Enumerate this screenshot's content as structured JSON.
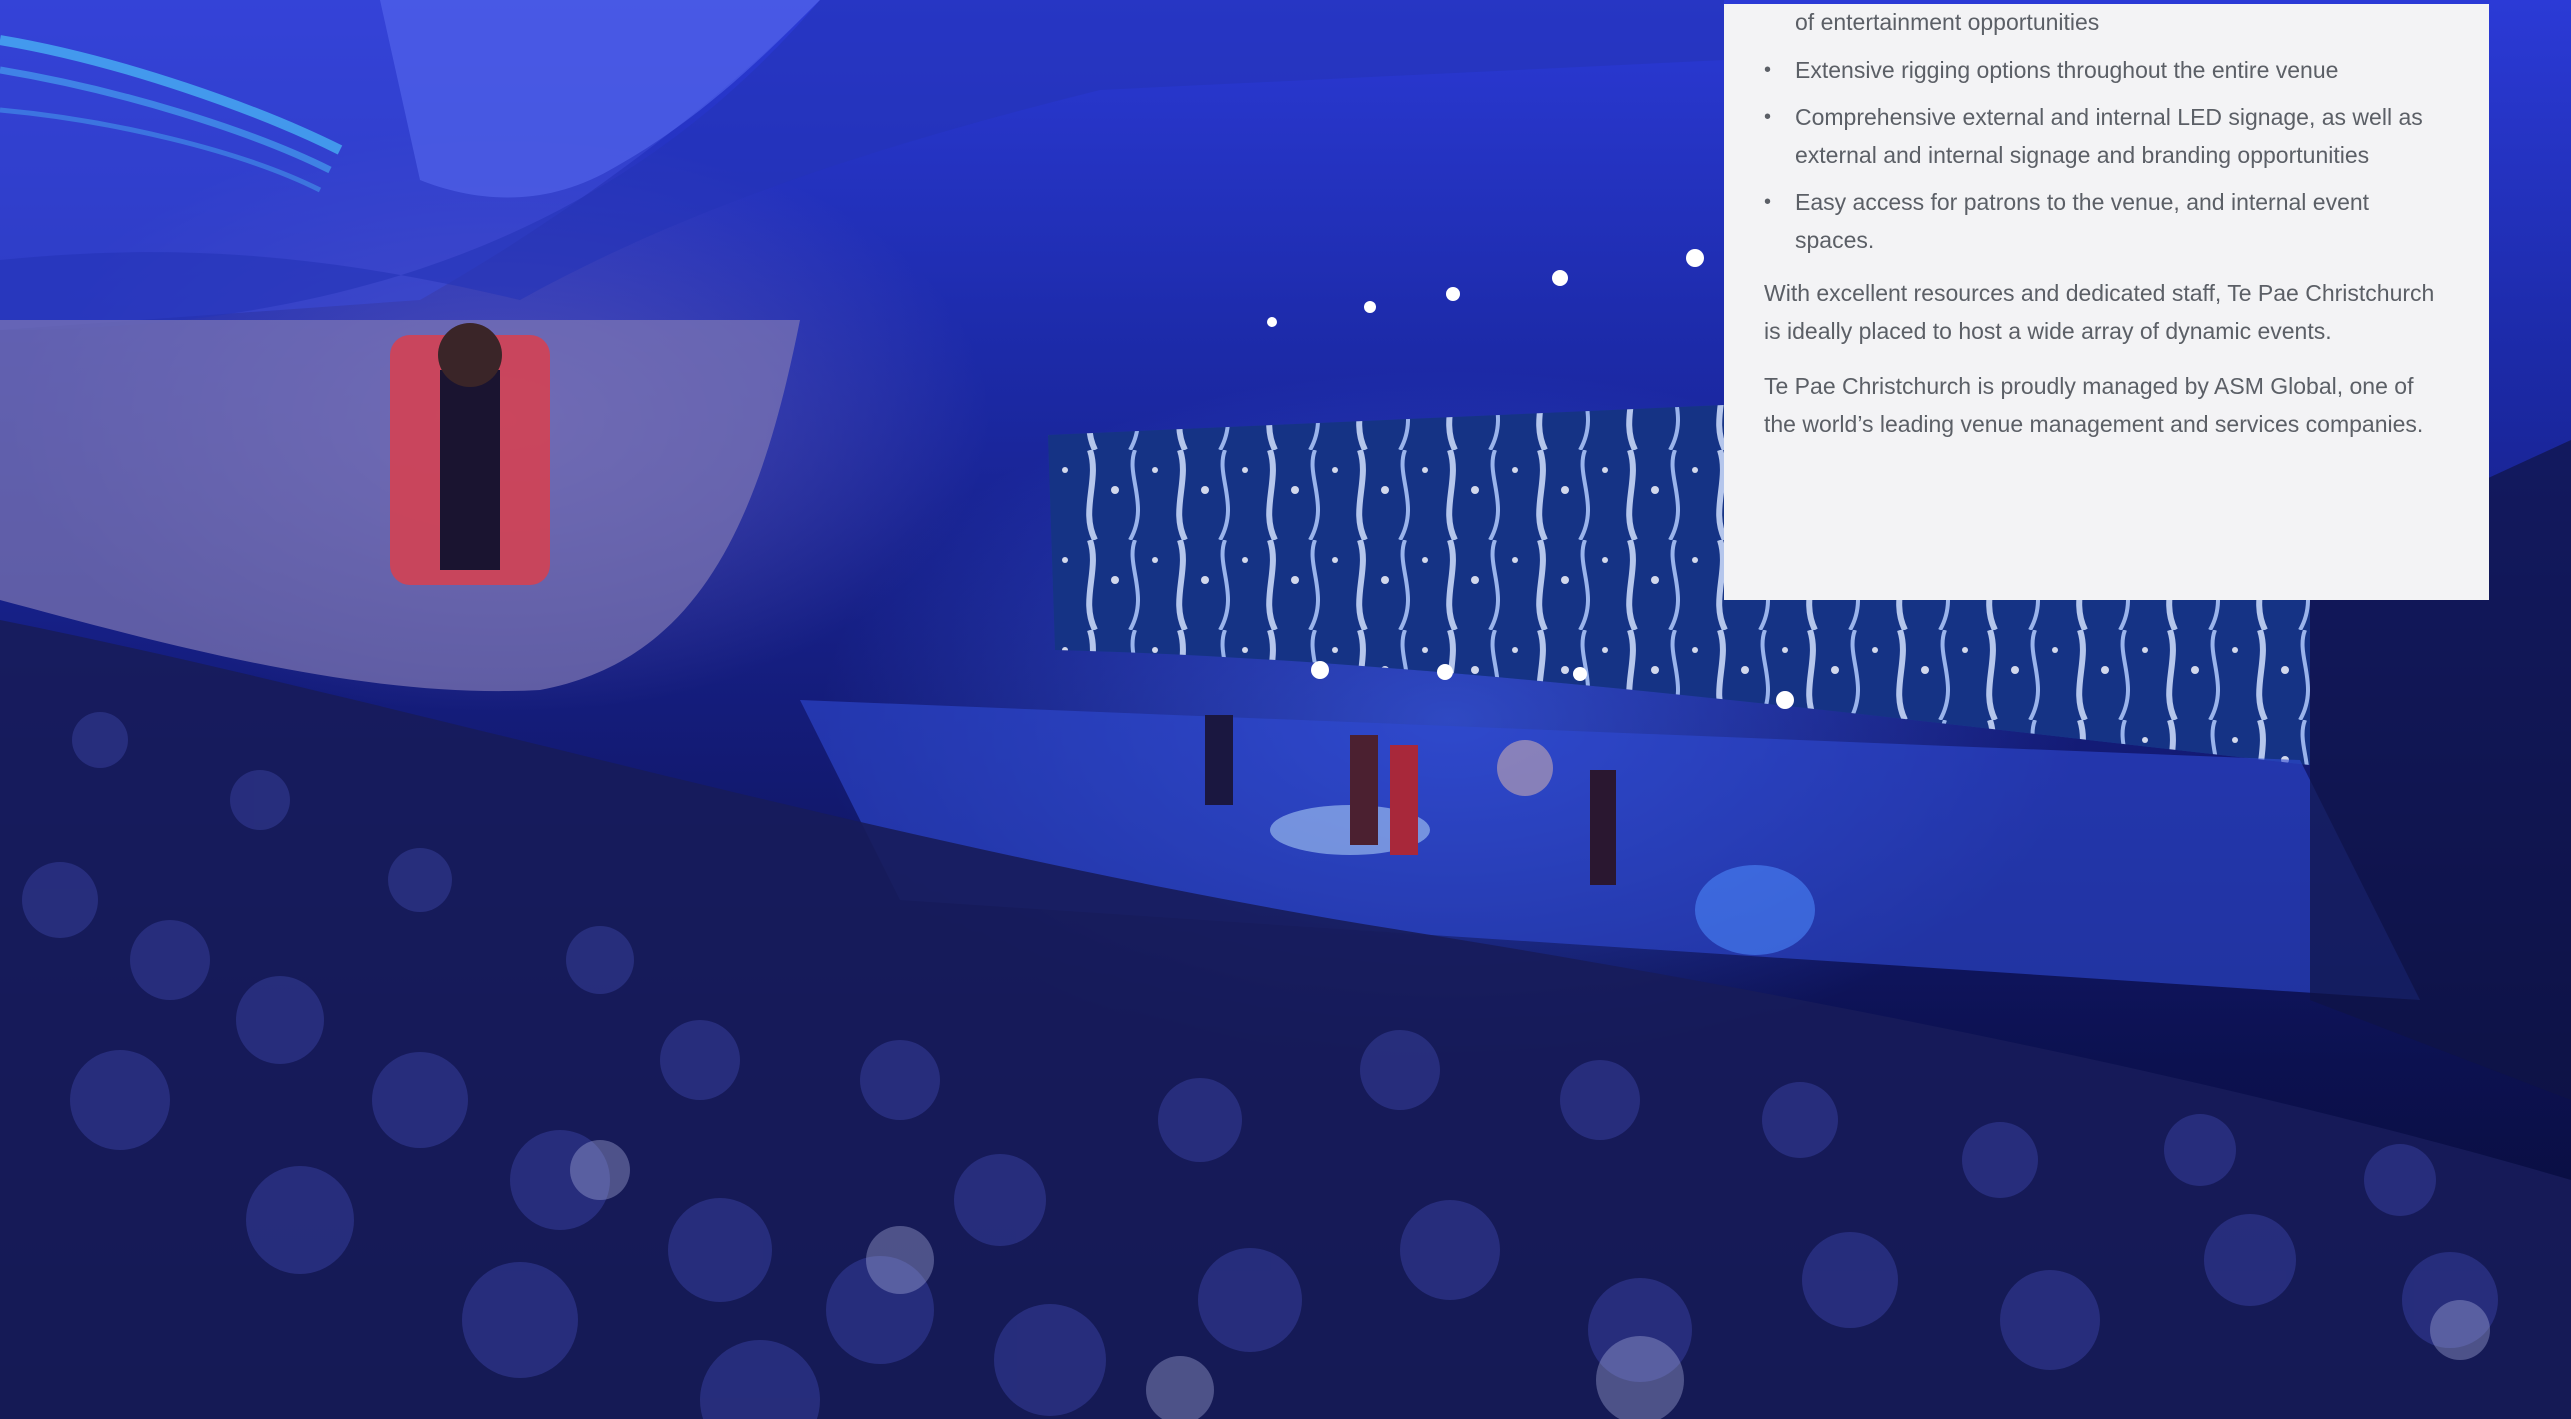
{
  "panel": {
    "partial_line": "of entertainment opportunities",
    "bullets": [
      "Extensive rigging options throughout the entire venue",
      "Comprehensive external and internal LED signage, as well as external and internal signage and branding opportunities",
      "Easy access for patrons to the venue, and internal event spaces."
    ],
    "paragraphs": [
      "With excellent resources and dedicated staff, Te Pae Christchurch is ideally placed to host a wide array of dynamic events.",
      "Te Pae Christchurch is proudly managed by ASM Global, one of the world’s leading venue management and services companies."
    ]
  },
  "colors": {
    "panel_bg": "#f3f3f5",
    "text": "#5b5f66",
    "venue_blue": "#1c2aa8"
  }
}
